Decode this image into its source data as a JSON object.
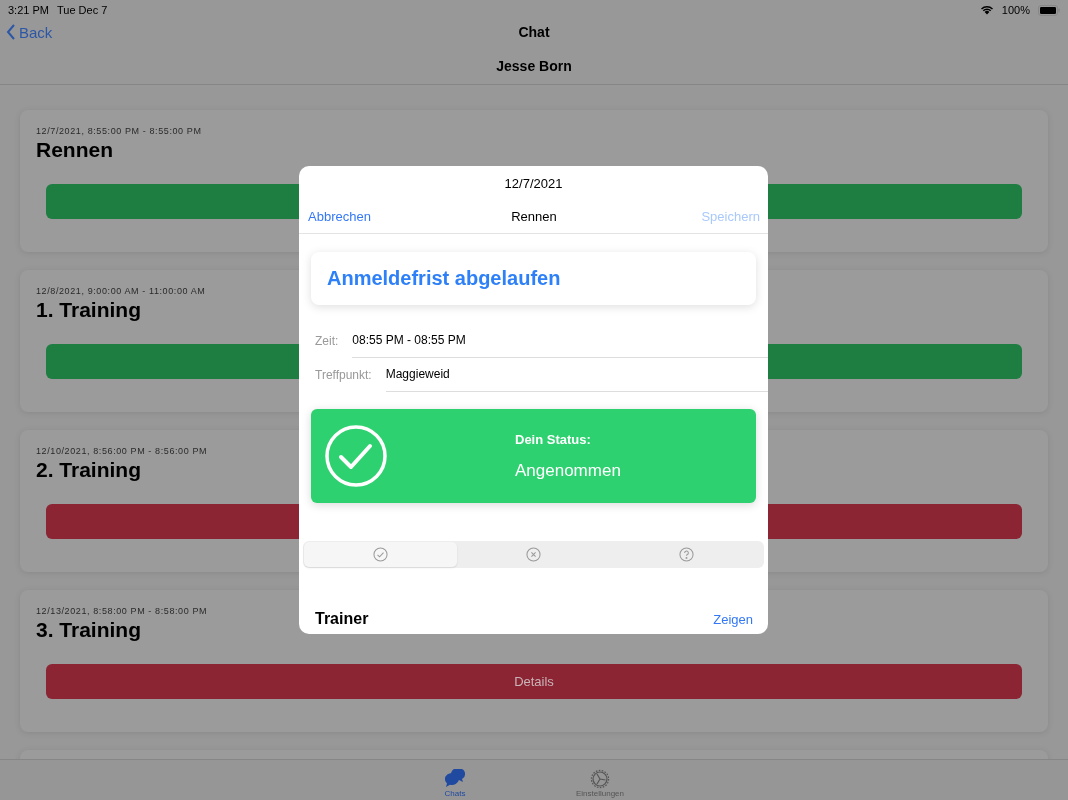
{
  "status_bar": {
    "time": "3:21 PM",
    "date": "Tue Dec 7",
    "battery": "100%"
  },
  "nav": {
    "back": "Back",
    "title": "Chat",
    "subtitle": "Jesse Born"
  },
  "events": [
    {
      "datetime": "12/7/2021, 8:55:00 PM - 8:55:00 PM",
      "title": "Rennen",
      "color": "#1e7e42"
    },
    {
      "datetime": "12/8/2021, 9:00:00 AM - 11:00:00 AM",
      "title": "1. Training",
      "color": "#1e7e42"
    },
    {
      "datetime": "12/10/2021, 8:56:00 PM - 8:56:00 PM",
      "title": "2. Training",
      "color": "#8b2533"
    },
    {
      "datetime": "12/13/2021, 8:58:00 PM - 8:58:00 PM",
      "title": "3. Training",
      "color": "#8b2533",
      "button_label": "Details"
    }
  ],
  "modal": {
    "date": "12/7/2021",
    "cancel": "Abbrechen",
    "title": "Rennen",
    "save": {
      "label": "Speichern",
      "disabled": true
    },
    "notice": "Anmeldefrist abgelaufen",
    "fields": [
      {
        "label": "Zeit:",
        "value": "08:55 PM - 08:55 PM"
      },
      {
        "label": "Treffpunkt:",
        "value": "Maggieweid"
      }
    ],
    "status": {
      "kind": "accepted",
      "label": "Dein Status:",
      "value": "Angenommen"
    },
    "segments": [
      {
        "kind": "accept",
        "selected": true
      },
      {
        "kind": "decline",
        "selected": false
      },
      {
        "kind": "maybe",
        "selected": false
      }
    ],
    "section": {
      "title": "Trainer",
      "action": "Zeigen"
    }
  },
  "tab_bar": [
    {
      "kind": "chats",
      "label": "Chats",
      "selected": true
    },
    {
      "kind": "settings",
      "label": "Einstellungen",
      "selected": false
    }
  ]
}
